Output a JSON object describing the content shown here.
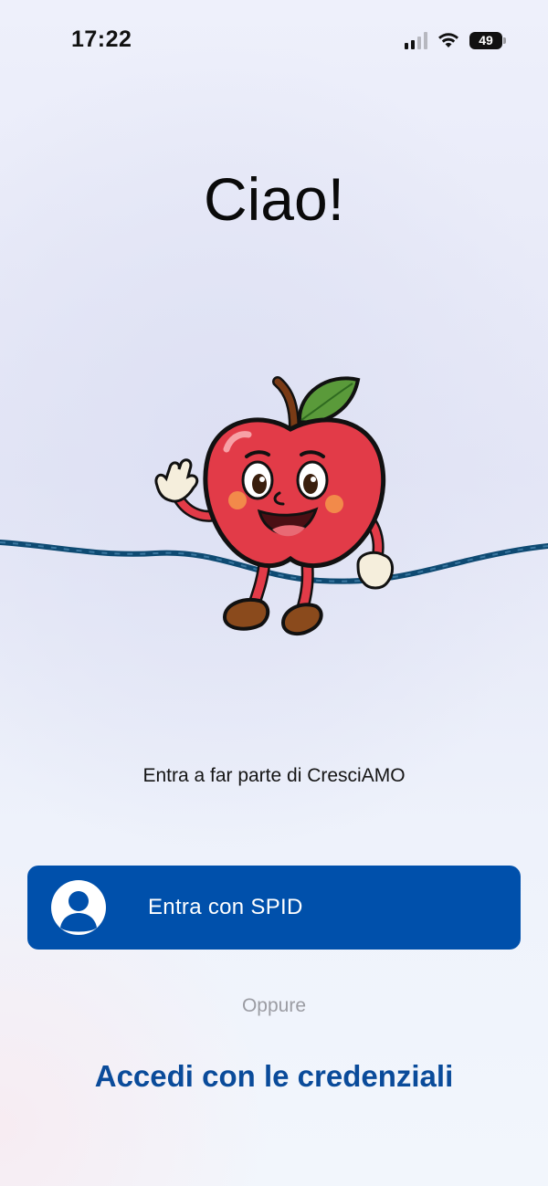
{
  "status_bar": {
    "time": "17:22",
    "battery": "49"
  },
  "greeting": "Ciao!",
  "mascot": {
    "icon": "apple-mascot-icon"
  },
  "tagline": "Entra a far parte di CresciAMO",
  "spid_button": {
    "label": "Entra con SPID",
    "icon": "user-avatar-icon"
  },
  "divider": "Oppure",
  "credentials_link": "Accedi con le credenziali",
  "colors": {
    "primary": "#0050ab",
    "link": "#0a4b9a",
    "apple": "#e23b48",
    "rope": "#0e4a72"
  }
}
